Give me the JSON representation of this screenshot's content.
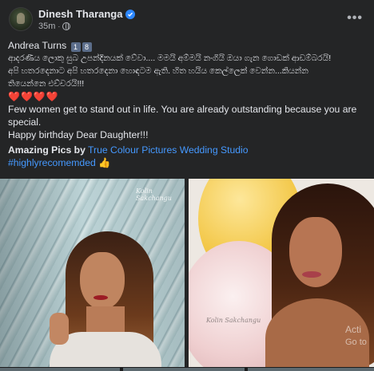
{
  "post": {
    "author": "Dinesh Tharanga",
    "verified_icon": "verified-badge-icon",
    "time": "35m",
    "audience_icon": "globe-icon",
    "menu_icon": "more-options-icon",
    "menu_glyph": "•••"
  },
  "content": {
    "line1_text": "Andrea Turns",
    "line1_digit1": "1",
    "line1_digit2": "8",
    "sinhala1": "ආදරණීය ලොකු සුබ උපන්දිනයක් වේවා.... මමයි අම්මයි නංගියි ඔයා ගැන ගොඩක් ආඩම්බරයි!",
    "sinhala2": "අපි හතරදෙනාට අපි හතරදෙනා හොඳටම ඇති. හිත හයිය කෙල්ලෙක් වෙන්න...කියන්න",
    "sinhala3": "තියෙන්නෙ එච්චරයි!!!",
    "hearts": "❤️❤️❤️❤️",
    "english1": "Few women get to stand out in life. You are already outstanding because you are",
    "english2": "special.",
    "english3": "Happy birthday Dear Daughter!!!",
    "credit_prefix": "Amazing Pics by",
    "credit_link": "True Colour Pictures Wedding Studio",
    "hashtag": "#highlyrecomemded",
    "hashtag_emoji": "👍"
  },
  "photos": {
    "watermark": "Kolin Sakchangu",
    "overlay_line1": "Acti",
    "overlay_line2": "Go to"
  },
  "colors": {
    "background": "#242526",
    "text": "#e4e6eb",
    "secondary_text": "#b0b3b8",
    "link": "#4599ff",
    "verified": "#2d88ff"
  }
}
